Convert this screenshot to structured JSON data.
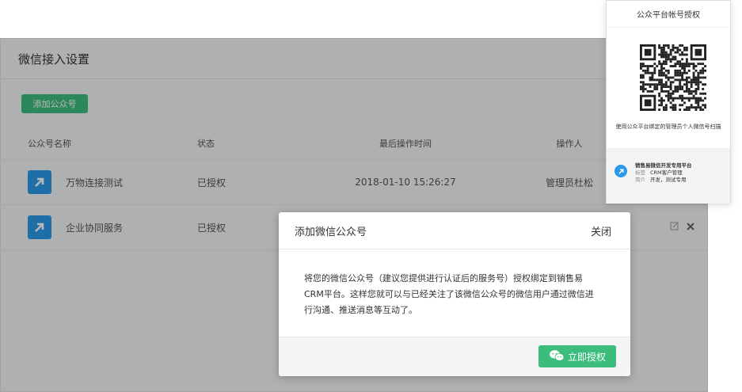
{
  "page": {
    "title": "微信接入设置",
    "add_button": "添加公众号"
  },
  "table": {
    "headers": [
      "公众号名称",
      "状态",
      "最后操作时间",
      "操作人"
    ],
    "rows": [
      {
        "name": "万物连接测试",
        "status": "已授权",
        "time": "2018-01-10 15:26:27",
        "operator": "管理员杜松"
      },
      {
        "name": "企业协同服务",
        "status": "已授权",
        "time": "",
        "operator": ""
      }
    ]
  },
  "dialog": {
    "title": "添加微信公众号",
    "close": "关闭",
    "body_line1": "将您的微信公众号（建议您提供进行认证后的服务号）授权绑定到销售易",
    "body_line2": "CRM平台。这样您就可以与已经关注了该微信公众号的微信用户通过微信进",
    "body_line3": "行沟通、推送消息等互动了。",
    "auth_button": "立即授权"
  },
  "popup": {
    "title": "公众平台帐号授权",
    "tip": "使用公众平台绑定的管理员个人微信号扫描",
    "app_name": "销售易微信开发专用平台",
    "tag_label": "标签",
    "tag_value": "CRM客户管理",
    "intro_label": "简介",
    "intro_value": "开发，测试专用"
  },
  "colors": {
    "accent_green": "#3dbd7d",
    "accent_blue": "#2a9ae8"
  },
  "icons": {
    "account": "arrow-up-right-icon",
    "edit": "edit-icon",
    "delete": "close-icon",
    "wechat": "wechat-icon",
    "qr": "qr-code"
  }
}
